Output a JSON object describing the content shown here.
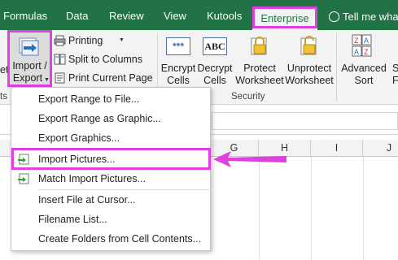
{
  "tabs": [
    {
      "label": "Formulas",
      "active": false
    },
    {
      "label": "Data",
      "active": false
    },
    {
      "label": "Review",
      "active": false
    },
    {
      "label": "View",
      "active": false
    },
    {
      "label": "Kutools",
      "active": false
    },
    {
      "label": "Enterprise",
      "active": true
    }
  ],
  "tell_me": "Tell me what",
  "ribbon": {
    "cut_left_fragment": "et",
    "import_export": {
      "line1": "Import /",
      "line2": "Export",
      "icon": "import-export-icon"
    },
    "small_buttons": [
      {
        "label": "Printing",
        "icon": "printer-icon",
        "has_dropdown": true
      },
      {
        "label": "Split to Columns",
        "icon": "split-columns-icon",
        "has_dropdown": false
      },
      {
        "label": "Print Current Page",
        "icon": "print-page-icon",
        "has_dropdown": false
      }
    ],
    "security": [
      {
        "line1": "Encrypt",
        "line2": "Cells",
        "icon": "encrypt-icon",
        "glyph": "***"
      },
      {
        "line1": "Decrypt",
        "line2": "Cells",
        "icon": "decrypt-icon",
        "glyph": "ABC"
      },
      {
        "line1": "Protect",
        "line2": "Worksheet",
        "icon": "lock-icon"
      },
      {
        "line1": "Unprotect",
        "line2": "Worksheet",
        "icon": "unlock-icon"
      }
    ],
    "security_group_label": "Security",
    "left_group_fragment": "ts",
    "advanced_sort": {
      "line1": "Advanced",
      "line2": "Sort",
      "icon": "sort-az-icon"
    },
    "cut_right_fragment": "S",
    "cut_right_fragment2": "F"
  },
  "columns": [
    "G",
    "H",
    "I",
    "J"
  ],
  "menu": {
    "items": [
      {
        "label": "Export Range to File...",
        "icon": ""
      },
      {
        "label": "Export Range as Graphic...",
        "icon": ""
      },
      {
        "label": "Export Graphics...",
        "icon": ""
      },
      {
        "label": "Import Pictures...",
        "icon": "import-pictures-icon",
        "highlighted": true
      },
      {
        "label": "Match Import Pictures...",
        "icon": "match-import-icon"
      },
      {
        "label": "Insert File at Cursor...",
        "icon": ""
      },
      {
        "label": "Filename List...",
        "icon": ""
      },
      {
        "label": "Create Folders from Cell Contents...",
        "icon": ""
      }
    ]
  },
  "colors": {
    "tab_bar": "#217346",
    "highlight": "#e040e0",
    "ribbon_bg": "#f3f3f3"
  }
}
